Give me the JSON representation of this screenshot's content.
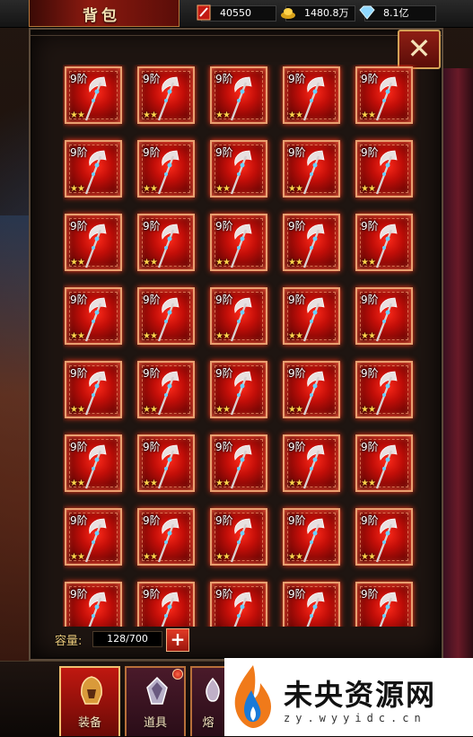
{
  "header": {
    "title": "背包",
    "resources": [
      {
        "name": "vitality",
        "icon": "red-scroll-icon",
        "value": "40550"
      },
      {
        "name": "gold",
        "icon": "gold-ingot-icon",
        "value": "1480.8万"
      },
      {
        "name": "diamond",
        "icon": "diamond-icon",
        "value": "8.1亿"
      }
    ]
  },
  "close_label": "✕",
  "inventory": {
    "item_level": "9阶",
    "item_stars": "★★",
    "rows": 8,
    "cols": 5
  },
  "capacity": {
    "label": "容量:",
    "value": "128/700",
    "add_label": "+"
  },
  "tabs": [
    {
      "label": "装备",
      "icon": "armor-helmet-icon",
      "active": true
    },
    {
      "label": "道具",
      "icon": "crystal-icon",
      "active": false
    },
    {
      "label": "熔",
      "icon": "furnace-icon",
      "active": false
    }
  ],
  "watermark": {
    "title": "未央资源网",
    "url": "zy.wyyidc.cn"
  },
  "colors": {
    "accent_red": "#c20e08",
    "gold": "#ffd24a",
    "border_gold": "#d4a257"
  }
}
